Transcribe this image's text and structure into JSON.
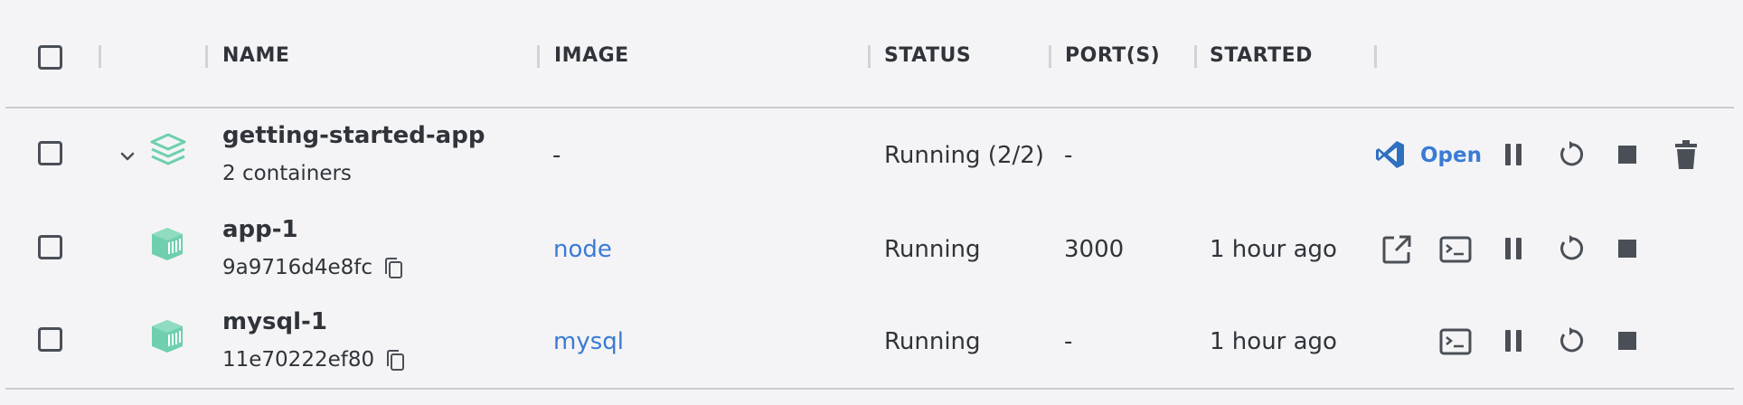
{
  "columns": {
    "name": "NAME",
    "image": "IMAGE",
    "status": "STATUS",
    "ports": "PORT(S)",
    "started": "STARTED"
  },
  "rows": [
    {
      "name": "getting-started-app",
      "sub": "2 containers",
      "image": "-",
      "status": "Running (2/2)",
      "ports": "-",
      "started": "",
      "open_label": "Open",
      "kind": "compose-stack"
    },
    {
      "name": "app-1",
      "sub": "9a9716d4e8fc",
      "image": "node",
      "status": "Running",
      "ports": "3000",
      "started": "1 hour ago",
      "kind": "container"
    },
    {
      "name": "mysql-1",
      "sub": "11e70222ef80",
      "image": "mysql",
      "status": "Running",
      "ports": "-",
      "started": "1 hour ago",
      "kind": "container"
    }
  ],
  "icons": {
    "stack": "layers-icon",
    "container": "container-icon",
    "copy": "copy-icon",
    "vscode": "vscode-icon",
    "pause": "pause-icon",
    "restart": "restart-icon",
    "stop": "stop-icon",
    "delete": "trash-icon",
    "open_browser": "open-in-browser-icon",
    "terminal": "terminal-icon",
    "expand": "chevron-down-icon"
  },
  "colors": {
    "accent": "#3a7bd5",
    "container_green": "#6fcfae",
    "icon_dark": "#4a4f57"
  }
}
